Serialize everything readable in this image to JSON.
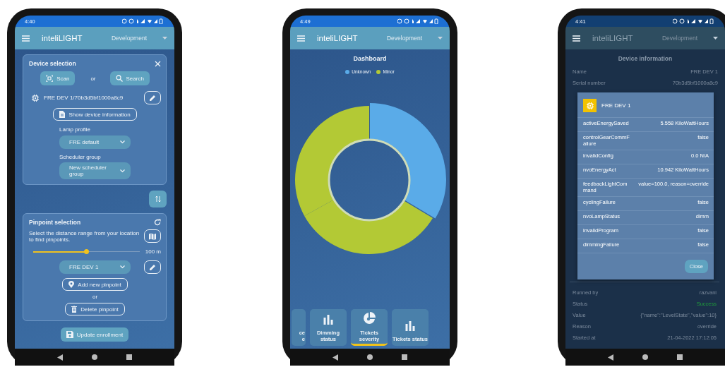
{
  "phones": [
    {
      "kind": "enrollment",
      "status_time": "4:40",
      "app_title": "inteliLIGHT",
      "environment": "Development",
      "device_selection": {
        "title": "Device selection",
        "scan": "Scan",
        "or": "or",
        "search": "Search",
        "device": "FRE DEV 1/70b3d5bf1000a8c9",
        "show_info": "Show device information",
        "lamp_profile": {
          "label": "Lamp profile",
          "value": "FRE default"
        },
        "scheduler_group": {
          "label": "Scheduler group",
          "value": "New scheduler group"
        }
      },
      "pinpoint_selection": {
        "title": "Pinpoint selection",
        "description": "Select the distance range from your location to find pinpoints.",
        "distance": {
          "level": 0.5,
          "reading": "100 m"
        },
        "pinpoint": "FRE DEV 1",
        "add": "Add new pinpoint",
        "or": "or",
        "delete": "Delete pinpoint"
      },
      "update_button": "Update enrollment"
    },
    {
      "kind": "dashboard",
      "status_time": "4:49",
      "app_title": "inteliLIGHT",
      "environment": "Development",
      "dashboard": {
        "title": "Dashboard",
        "legend": [
          {
            "label": "Unknown",
            "color": "#5aabe8"
          },
          {
            "label": "Minor",
            "color": "#b3c935"
          }
        ]
      },
      "tiles": [
        {
          "kind": "cut",
          "label": "ce e",
          "selected": false
        },
        {
          "kind": "bars",
          "label": "Dimming status",
          "selected": false
        },
        {
          "kind": "pie",
          "label": "Tickets severity",
          "selected": true
        },
        {
          "kind": "bars",
          "label": "Tickets status",
          "selected": false
        }
      ]
    },
    {
      "kind": "device_info",
      "status_time": "4:41",
      "app_title": "inteliLIGHT",
      "environment": "Development",
      "screen_title": "Device information",
      "fields": [
        {
          "label": "Name",
          "value": "FRE DEV 1"
        },
        {
          "label": "Serial number",
          "value": "70b3d5bf1000a8c9"
        }
      ],
      "command": [
        {
          "label": "Runned by",
          "value": "razvani",
          "kind": "plain"
        },
        {
          "label": "Status",
          "value": "Success",
          "kind": "success"
        },
        {
          "label": "Value",
          "value": "{\"name\":\"LevelState\",\"value\":10}",
          "kind": "plain"
        },
        {
          "label": "Reason",
          "value": "override",
          "kind": "plain"
        },
        {
          "label": "Started at",
          "value": "21-04-2022 17:12:05",
          "kind": "plain"
        }
      ],
      "dialog": {
        "title": "FRE DEV 1",
        "rows": [
          {
            "key": "activeEnergySaved",
            "value": "5.558 KiloWattHours"
          },
          {
            "key": "controlGearCommFailure",
            "value": "false"
          },
          {
            "key": "invalidConfig",
            "value": "0.0 N/A"
          },
          {
            "key": "nvoEnergyAct",
            "value": "10.942 KiloWattHours"
          },
          {
            "key": "feedbackLightCommand",
            "value": "value=100.0, reason=override"
          },
          {
            "key": "cyclingFailure",
            "value": "false"
          },
          {
            "key": "nvoLampStatus",
            "value": "dimm"
          },
          {
            "key": "invalidProgram",
            "value": "false"
          },
          {
            "key": "dimmingFailure",
            "value": "false"
          }
        ],
        "close": "Close"
      }
    }
  ]
}
